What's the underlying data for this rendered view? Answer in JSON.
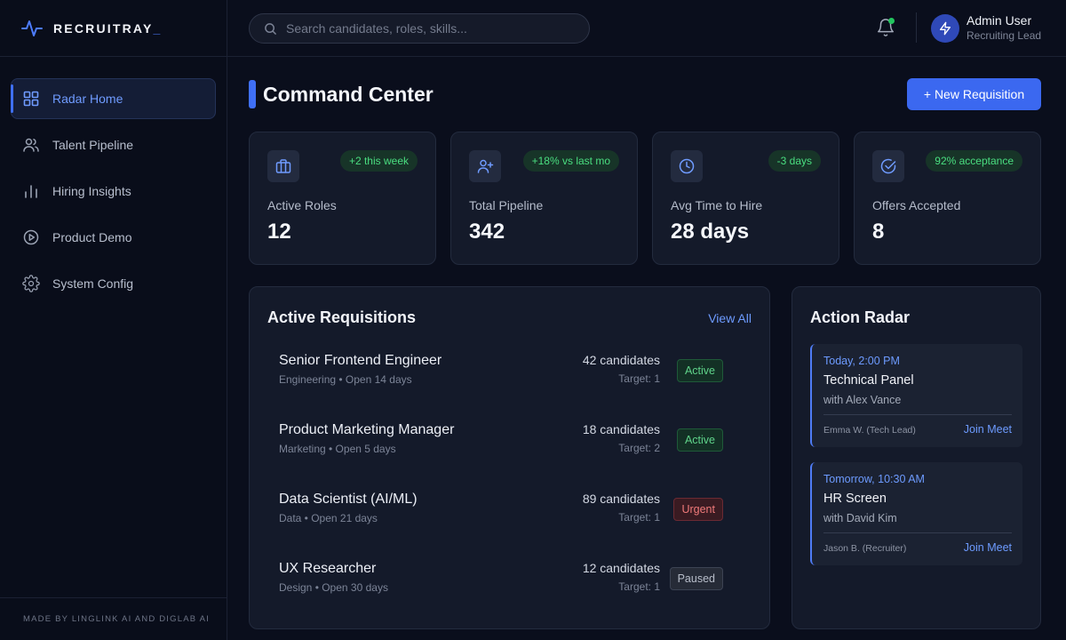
{
  "brand": {
    "name": "RECRUITRAY",
    "cursor": "_"
  },
  "sidebar": {
    "items": [
      {
        "label": "Radar Home",
        "icon": "grid-icon",
        "active": true
      },
      {
        "label": "Talent Pipeline",
        "icon": "users-icon"
      },
      {
        "label": "Hiring Insights",
        "icon": "bar-chart-icon"
      },
      {
        "label": "Product Demo",
        "icon": "play-circle-icon"
      },
      {
        "label": "System Config",
        "icon": "gear-icon"
      }
    ],
    "footer": "MADE BY LINGLINK AI AND DIGLAB AI"
  },
  "topbar": {
    "search_placeholder": "Search candidates, roles, skills...",
    "user": {
      "name": "Admin User",
      "role": "Recruiting Lead"
    }
  },
  "main": {
    "title": "Command Center",
    "new_button": "+ New Requisition",
    "stats": [
      {
        "label": "Active Roles",
        "value": "12",
        "badge": "+2 this week",
        "icon": "briefcase-icon"
      },
      {
        "label": "Total Pipeline",
        "value": "342",
        "badge": "+18% vs last mo",
        "icon": "user-plus-icon"
      },
      {
        "label": "Avg Time to Hire",
        "value": "28 days",
        "badge": "-3 days",
        "icon": "clock-icon"
      },
      {
        "label": "Offers Accepted",
        "value": "8",
        "badge": "92% acceptance",
        "icon": "check-circle-icon"
      }
    ],
    "requisitions": {
      "title": "Active Requisitions",
      "view_all": "View All",
      "rows": [
        {
          "title": "Senior Frontend Engineer",
          "sub": "Engineering • Open 14 days",
          "count": "42 candidates",
          "target": "Target: 1",
          "status": "Active"
        },
        {
          "title": "Product Marketing Manager",
          "sub": "Marketing • Open 5 days",
          "count": "18 candidates",
          "target": "Target: 2",
          "status": "Active"
        },
        {
          "title": "Data Scientist (AI/ML)",
          "sub": "Data • Open 21 days",
          "count": "89 candidates",
          "target": "Target: 1",
          "status": "Urgent"
        },
        {
          "title": "UX Researcher",
          "sub": "Design • Open 30 days",
          "count": "12 candidates",
          "target": "Target: 1",
          "status": "Paused"
        }
      ]
    },
    "action_radar": {
      "title": "Action Radar",
      "events": [
        {
          "time": "Today, 2:00 PM",
          "title": "Technical Panel",
          "with": "with Alex Vance",
          "person": "Emma W. (Tech Lead)",
          "action": "Join Meet"
        },
        {
          "time": "Tomorrow, 10:30 AM",
          "title": "HR Screen",
          "with": "with David Kim",
          "person": "Jason B. (Recruiter)",
          "action": "Join Meet"
        }
      ]
    }
  },
  "colors": {
    "accent": "#3b68f0",
    "success": "#4ade80",
    "danger": "#f07a7a",
    "background": "#0a0e1c"
  }
}
